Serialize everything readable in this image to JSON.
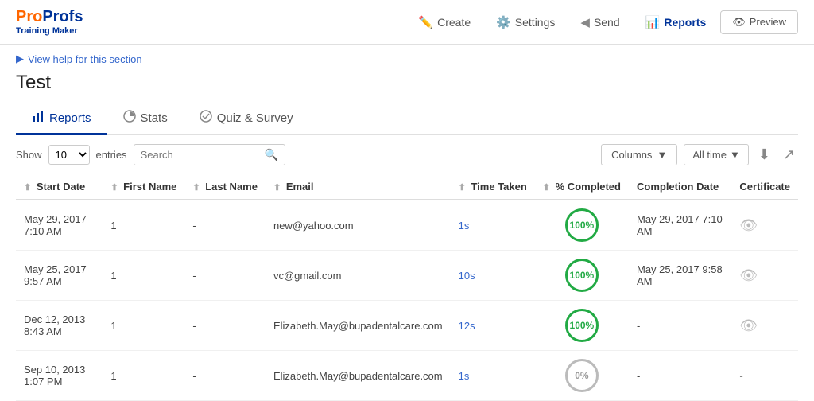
{
  "logo": {
    "brand": "ProProfs",
    "subtitle": "Training Maker"
  },
  "nav": {
    "items": [
      {
        "id": "create",
        "label": "Create",
        "icon": "✏️",
        "active": false
      },
      {
        "id": "settings",
        "label": "Settings",
        "icon": "⚙️",
        "active": false
      },
      {
        "id": "send",
        "label": "Send",
        "icon": "📤",
        "active": false
      },
      {
        "id": "reports",
        "label": "Reports",
        "icon": "📊",
        "active": true
      },
      {
        "id": "preview",
        "label": "Preview",
        "icon": "👁️",
        "active": false,
        "bordered": true
      }
    ]
  },
  "help_link": "View help for this section",
  "page_title": "Test",
  "tabs": [
    {
      "id": "reports",
      "label": "Reports",
      "icon": "bar",
      "active": true
    },
    {
      "id": "stats",
      "label": "Stats",
      "icon": "pie",
      "active": false
    },
    {
      "id": "quiz_survey",
      "label": "Quiz & Survey",
      "icon": "check",
      "active": false
    }
  ],
  "toolbar": {
    "show_label": "Show",
    "entries_value": "10",
    "entries_label": "entries",
    "search_placeholder": "Search",
    "columns_label": "Columns",
    "alltime_label": "All time"
  },
  "table": {
    "columns": [
      {
        "id": "start_date",
        "label": "Start Date"
      },
      {
        "id": "first_name",
        "label": "First Name"
      },
      {
        "id": "last_name",
        "label": "Last Name"
      },
      {
        "id": "email",
        "label": "Email"
      },
      {
        "id": "time_taken",
        "label": "Time Taken"
      },
      {
        "id": "pct_completed",
        "label": "% Completed"
      },
      {
        "id": "completion_date",
        "label": "Completion Date"
      },
      {
        "id": "certificate",
        "label": "Certificate"
      }
    ],
    "rows": [
      {
        "start_date": "May 29, 2017 7:10 AM",
        "first_name": "1",
        "last_name": "-",
        "email": "new@yahoo.com",
        "time_taken": "1s",
        "pct_completed": "100%",
        "pct_type": "green",
        "completion_date": "May 29, 2017 7:10 AM",
        "certificate": "eye"
      },
      {
        "start_date": "May 25, 2017 9:57 AM",
        "first_name": "1",
        "last_name": "-",
        "email": "vc@gmail.com",
        "time_taken": "10s",
        "pct_completed": "100%",
        "pct_type": "green",
        "completion_date": "May 25, 2017 9:58 AM",
        "certificate": "eye"
      },
      {
        "start_date": "Dec 12, 2013 8:43 AM",
        "first_name": "1",
        "last_name": "-",
        "email": "Elizabeth.May@bupadentalcare.com",
        "time_taken": "12s",
        "pct_completed": "100%",
        "pct_type": "green",
        "completion_date": "-",
        "certificate": "eye"
      },
      {
        "start_date": "Sep 10, 2013 1:07 PM",
        "first_name": "1",
        "last_name": "-",
        "email": "Elizabeth.May@bupadentalcare.com",
        "time_taken": "1s",
        "pct_completed": "0%",
        "pct_type": "gray",
        "completion_date": "-",
        "certificate": "-"
      }
    ]
  }
}
